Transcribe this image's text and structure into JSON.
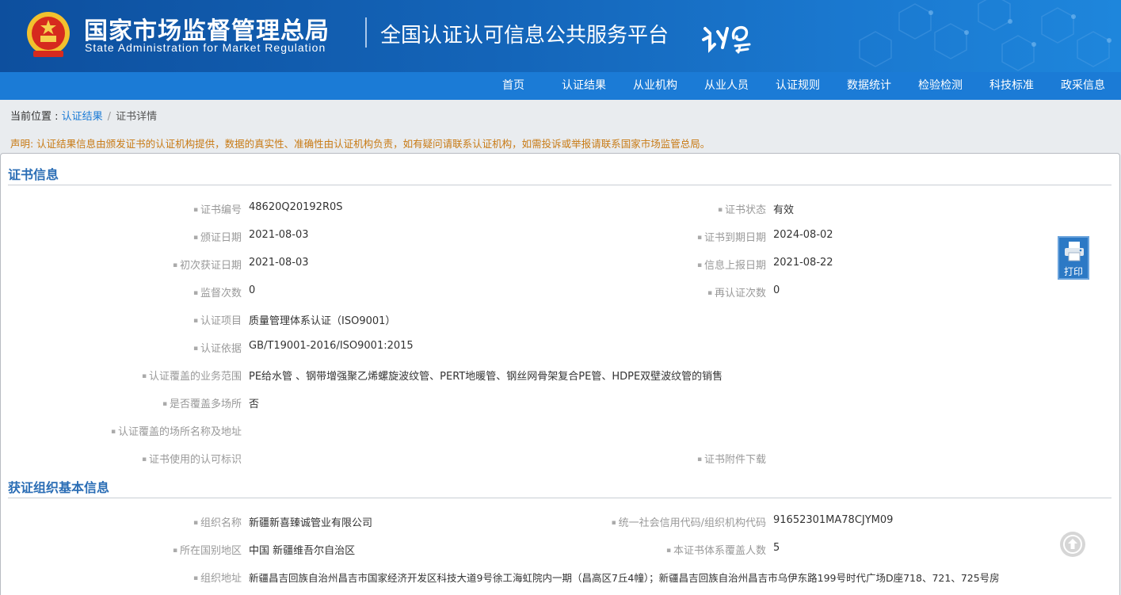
{
  "header": {
    "title_cn": "国家市场监督管理总局",
    "title_en": "State Administration  for  Market Regulation",
    "platform": "全国认证认可信息公共服务平台"
  },
  "nav": [
    "首页",
    "认证结果",
    "从业机构",
    "从业人员",
    "认证规则",
    "数据统计",
    "检验检测",
    "科技标准",
    "政采信息"
  ],
  "breadcrumb": {
    "prefix": "当前位置 : ",
    "link": "认证结果",
    "divider": "/",
    "current": "证书详情"
  },
  "notice": "声明: 认证结果信息由颁发证书的认证机构提供，数据的真实性、准确性由认证机构负责，如有疑问请联系认证机构，如需投诉或举报请联系国家市场监管总局。",
  "cert": {
    "title": "证书信息",
    "rows": [
      {
        "l_label": "证书编号",
        "l_value": "48620Q20192R0S",
        "r_label": "证书状态",
        "r_value": "有效"
      },
      {
        "l_label": "颁证日期",
        "l_value": "2021-08-03",
        "r_label": "证书到期日期",
        "r_value": "2024-08-02"
      },
      {
        "l_label": "初次获证日期",
        "l_value": "2021-08-03",
        "r_label": "信息上报日期",
        "r_value": "2021-08-22"
      },
      {
        "l_label": "监督次数",
        "l_value": "0",
        "r_label": "再认证次数",
        "r_value": "0"
      },
      {
        "l_label": "认证项目",
        "l_value": "质量管理体系认证（ISO9001）",
        "r_label": "",
        "r_value": ""
      },
      {
        "l_label": "认证依据",
        "l_value": "GB/T19001-2016/ISO9001:2015",
        "r_label": "",
        "r_value": ""
      },
      {
        "l_label": "认证覆盖的业务范围",
        "l_value": "PE给水管 、钢带增强聚乙烯螺旋波纹管、PERT地暖管、钢丝网骨架复合PE管、HDPE双壁波纹管的销售",
        "r_label": "",
        "r_value": ""
      },
      {
        "l_label": "是否覆盖多场所",
        "l_value": "否",
        "r_label": "",
        "r_value": ""
      },
      {
        "l_label": "认证覆盖的场所名称及地址",
        "l_value": "",
        "r_label": "",
        "r_value": ""
      },
      {
        "l_label": "证书使用的认可标识",
        "l_value": "",
        "r_label": "证书附件下载",
        "r_value": ""
      }
    ]
  },
  "org": {
    "title": "获证组织基本信息",
    "rows": [
      {
        "l_label": "组织名称",
        "l_value": "新疆新喜臻诚管业有限公司",
        "r_label": "统一社会信用代码/组织机构代码",
        "r_value": "91652301MA78CJYM09"
      },
      {
        "l_label": "所在国别地区",
        "l_value": "中国 新疆维吾尔自治区",
        "r_label": "本证书体系覆盖人数",
        "r_value": "5"
      },
      {
        "l_label": "组织地址",
        "l_value": "新疆昌吉回族自治州昌吉市国家经济开发区科技大道9号徐工海虹院内一期（昌高区7丘4幢）；新疆昌吉回族自治州昌吉市乌伊东路199号时代广场D座718、721、725号房",
        "r_label": "",
        "r_value": ""
      }
    ]
  },
  "print_label": "打印",
  "colors": {
    "header": "#1465b9",
    "nav": "#1b7bd6",
    "section_title": "#2a6db5",
    "notice": "#c87a14"
  }
}
